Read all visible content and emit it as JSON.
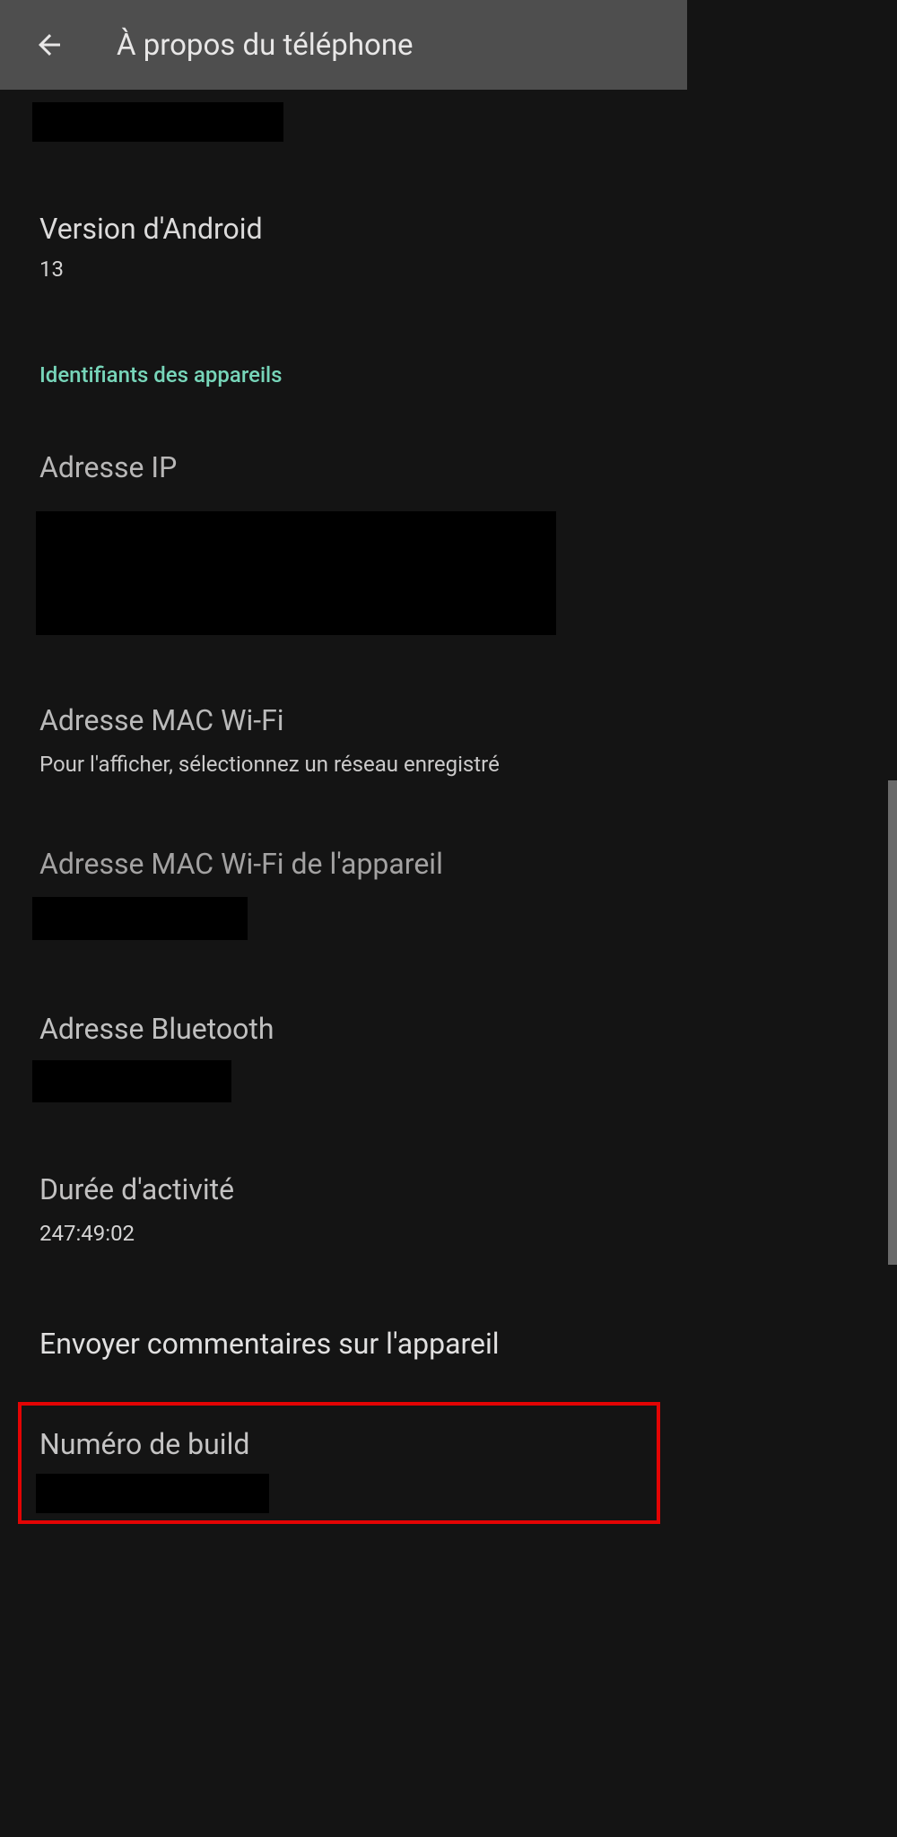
{
  "header": {
    "title": "À propos du téléphone"
  },
  "android_version": {
    "title": "Version d'Android",
    "value": "13"
  },
  "section_header": "Identifiants des appareils",
  "ip_address": {
    "title": "Adresse IP"
  },
  "mac_wifi": {
    "title": "Adresse MAC Wi-Fi",
    "subtitle": "Pour l'afficher, sélectionnez un réseau enregistré"
  },
  "mac_wifi_device": {
    "title": "Adresse MAC Wi-Fi de l'appareil"
  },
  "bluetooth": {
    "title": "Adresse Bluetooth"
  },
  "activity": {
    "title": "Durée d'activité",
    "value": "247:49:02"
  },
  "feedback": {
    "title": "Envoyer commentaires sur l'appareil"
  },
  "build": {
    "title": "Numéro de build"
  }
}
